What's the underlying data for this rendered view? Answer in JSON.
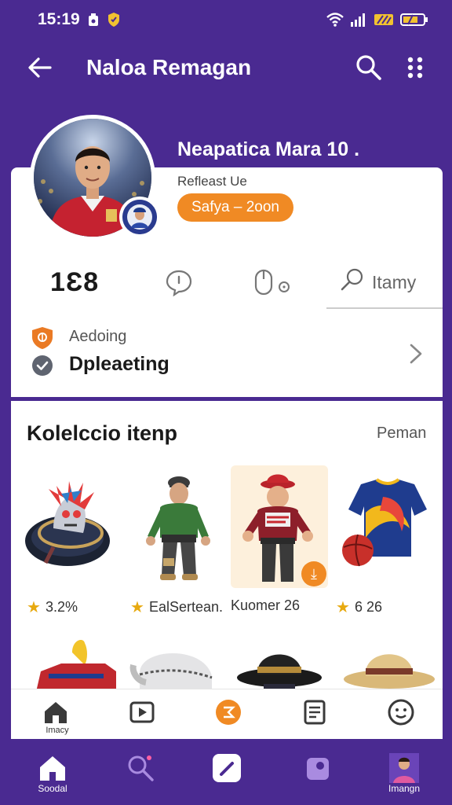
{
  "status_bar": {
    "time": "15:19"
  },
  "app_bar": {
    "title": "Naloa Remagan"
  },
  "profile": {
    "name": "Neapatica Mara 10 .",
    "sub_label": "Refleast Ue",
    "pill_text": "Safya – 2oon"
  },
  "stats": {
    "number": "1Ɛ8",
    "search_label": "Itamy"
  },
  "activity": {
    "label": "Aedoing",
    "title": "Dpleaeting"
  },
  "collection": {
    "title": "Kolelccio itenp",
    "link": "Peman",
    "items": [
      {
        "caption": "3.2%",
        "has_star": true
      },
      {
        "caption": "EalSertean.",
        "has_star": true
      },
      {
        "caption": "Kuomer 26",
        "has_star": false
      },
      {
        "caption": "6 26",
        "has_star": true
      }
    ]
  },
  "tabs": [
    {
      "icon": "home-icon",
      "label": "Imacy"
    },
    {
      "icon": "video-icon",
      "label": ""
    },
    {
      "icon": "coin-icon",
      "label": ""
    },
    {
      "icon": "document-icon",
      "label": ""
    },
    {
      "icon": "smile-icon",
      "label": ""
    }
  ],
  "nav": [
    {
      "icon": "home-icon",
      "label": "Soodal"
    },
    {
      "icon": "search-icon",
      "label": ""
    },
    {
      "icon": "edit-icon",
      "label": ""
    },
    {
      "icon": "bag-icon",
      "label": ""
    },
    {
      "icon": "profile-avatar-icon",
      "label": "Imangn"
    }
  ],
  "colors": {
    "brand_purple": "#4a2a91",
    "accent_orange": "#f08a24",
    "star_gold": "#e7a90f"
  }
}
